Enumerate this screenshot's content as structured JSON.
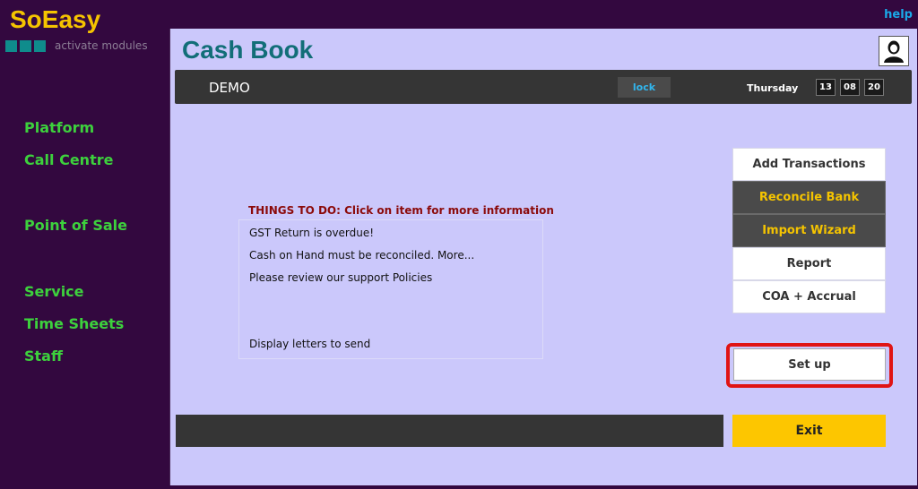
{
  "brand": {
    "name": "SoEasy",
    "modules_link": "activate modules",
    "help": "help"
  },
  "nav": [
    "Platform",
    "Call Centre",
    "Point of Sale",
    "Service",
    "Time Sheets",
    "Staff"
  ],
  "page": {
    "title": "Cash Book"
  },
  "header": {
    "company": "DEMO",
    "lock": "lock",
    "day": "Thursday",
    "date": [
      "13",
      "08",
      "20"
    ]
  },
  "todo": {
    "title": "THINGS TO DO: Click on item for more information",
    "items": [
      "GST Return is overdue!",
      "Cash on Hand must be reconciled. More...",
      "Please review our support Policies",
      "Display letters to send"
    ]
  },
  "actions": {
    "add_transactions": "Add Transactions",
    "reconcile_bank": "Reconcile Bank",
    "import_wizard": "Import Wizard",
    "report": "Report",
    "coa_accrual": "COA + Accrual",
    "setup": "Set up",
    "exit": "Exit"
  },
  "colors": {
    "sidebar_bg": "#33083f",
    "panel_bg": "#cbc8fb",
    "brand": "#f5c400",
    "nav_text": "#3dd13d",
    "title": "#126e78",
    "highlight": "#e01414",
    "exit_bg": "#fdc600"
  }
}
